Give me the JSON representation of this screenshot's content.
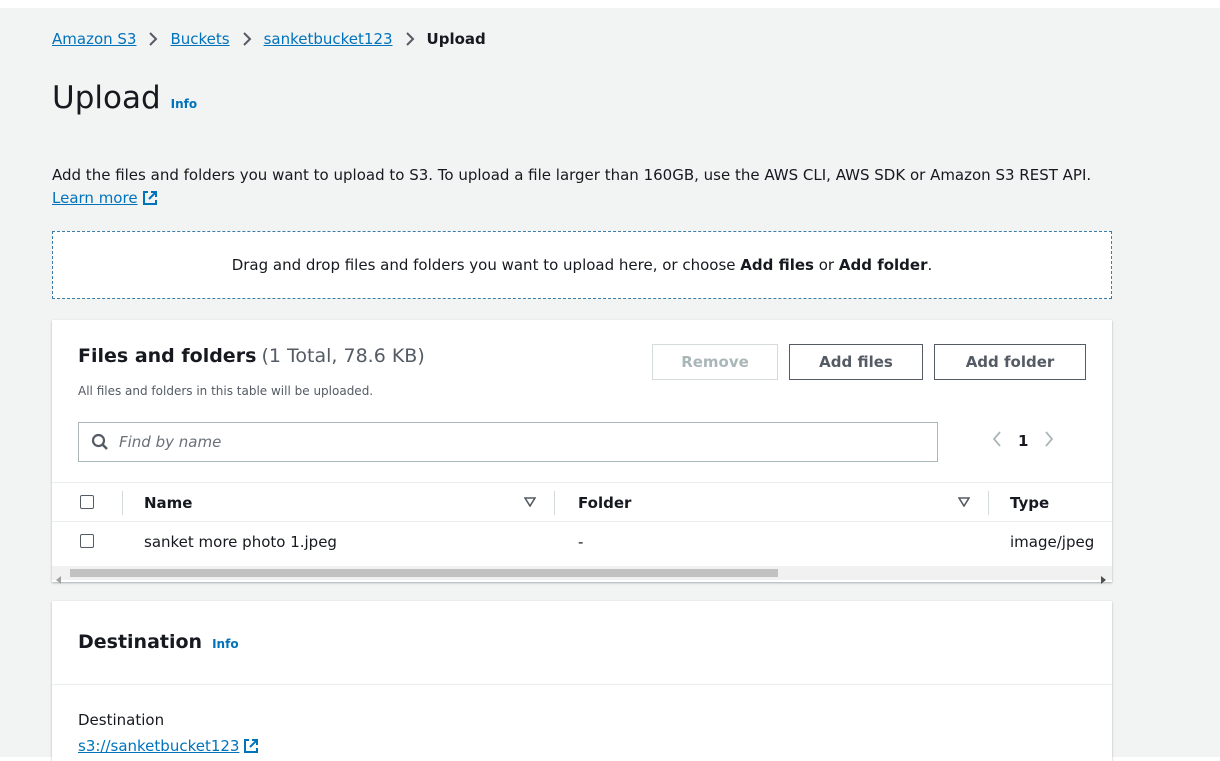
{
  "breadcrumb": {
    "items": [
      "Amazon S3",
      "Buckets",
      "sanketbucket123"
    ],
    "current": "Upload"
  },
  "header": {
    "title": "Upload",
    "info_label": "Info"
  },
  "description": {
    "text": "Add the files and folders you want to upload to S3. To upload a file larger than 160GB, use the AWS CLI, AWS SDK or Amazon S3 REST API.",
    "learn_more": "Learn more"
  },
  "dropzone": {
    "prefix": "Drag and drop files and folders you want to upload here, or choose",
    "add_files": "Add files",
    "or": "or",
    "add_folder": "Add folder",
    "suffix": "."
  },
  "files": {
    "title": "Files and folders",
    "count": "(1 Total, 78.6 KB)",
    "subtitle": "All files and folders in this table will be uploaded.",
    "buttons": {
      "remove": "Remove",
      "add_files": "Add files",
      "add_folder": "Add folder"
    },
    "search_placeholder": "Find by name",
    "page": "1",
    "columns": [
      "Name",
      "Folder",
      "Type"
    ],
    "rows": [
      {
        "name": "sanket more photo 1.jpeg",
        "folder": "-",
        "type": "image/jpeg"
      }
    ]
  },
  "destination": {
    "title": "Destination",
    "info_label": "Info",
    "label": "Destination",
    "link": "s3://sanketbucket123"
  },
  "colors": {
    "link": "#0073bb",
    "text": "#16191f",
    "background": "#f2f3f3"
  }
}
